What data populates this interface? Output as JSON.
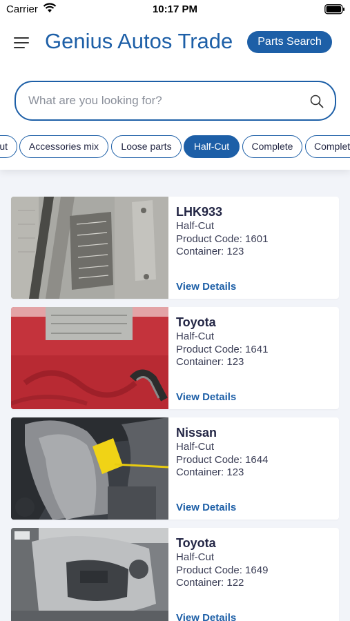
{
  "status_bar": {
    "carrier": "Carrier",
    "time": "10:17 PM"
  },
  "header": {
    "title": "Genius Autos Trade",
    "parts_search_label": "Parts Search"
  },
  "search": {
    "placeholder": "What are you looking for?",
    "value": ""
  },
  "filters": {
    "active": "Half-Cut",
    "chips": [
      "ut",
      "Accessories mix",
      "Loose parts",
      "Half-Cut",
      "Complete",
      "Complet"
    ]
  },
  "products": [
    {
      "name": "LHK933",
      "type": "Half-Cut",
      "product_code": "Product Code: 1601",
      "container": "Container: 123",
      "link_label": "View Details",
      "image": "vin-plate-photo"
    },
    {
      "name": "Toyota",
      "type": "Half-Cut",
      "product_code": "Product Code: 1641",
      "container": "Container: 123",
      "link_label": "View Details",
      "image": "red-engine-bay-photo"
    },
    {
      "name": "Nissan",
      "type": "Half-Cut",
      "product_code": "Product Code: 1644",
      "container": "Container: 123",
      "link_label": "View Details",
      "image": "dashboard-tag-photo"
    },
    {
      "name": "Toyota",
      "type": "Half-Cut",
      "product_code": "Product Code: 1649",
      "container": "Container: 122",
      "link_label": "View Details",
      "image": "grey-dashboard-photo"
    }
  ],
  "colors": {
    "accent": "#1d5fa7",
    "background": "#f2f4f9",
    "title_text": "#232645"
  }
}
